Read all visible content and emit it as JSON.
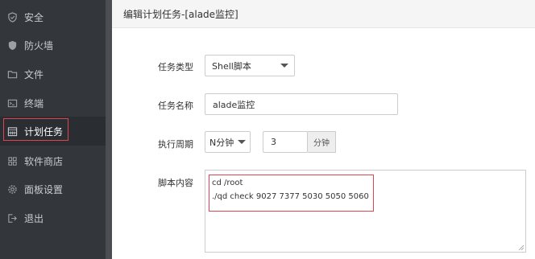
{
  "sidebar": {
    "items": [
      {
        "label": "安全",
        "icon": "shield-check-icon"
      },
      {
        "label": "防火墙",
        "icon": "firewall-shield-icon"
      },
      {
        "label": "文件",
        "icon": "folder-icon"
      },
      {
        "label": "终端",
        "icon": "terminal-icon"
      },
      {
        "label": "计划任务",
        "icon": "calendar-icon",
        "active": true
      },
      {
        "label": "软件商店",
        "icon": "grid-apps-icon"
      },
      {
        "label": "面板设置",
        "icon": "gear-icon"
      },
      {
        "label": "退出",
        "icon": "logout-icon"
      }
    ]
  },
  "panel": {
    "title": "编辑计划任务-[alade监控]"
  },
  "form": {
    "task_type": {
      "label": "任务类型",
      "value": "Shell脚本"
    },
    "task_name": {
      "label": "任务名称",
      "value": "alade监控"
    },
    "period": {
      "label": "执行周期",
      "unit_select": "N分钟",
      "value": "3",
      "addon": "分钟"
    },
    "script": {
      "label": "脚本内容",
      "lines": [
        "cd /root",
        "./qd check 9027 7377 5030 5050 5060"
      ]
    }
  },
  "colors": {
    "sidebar_bg": "#33373b",
    "highlight_border": "#e0454f"
  }
}
